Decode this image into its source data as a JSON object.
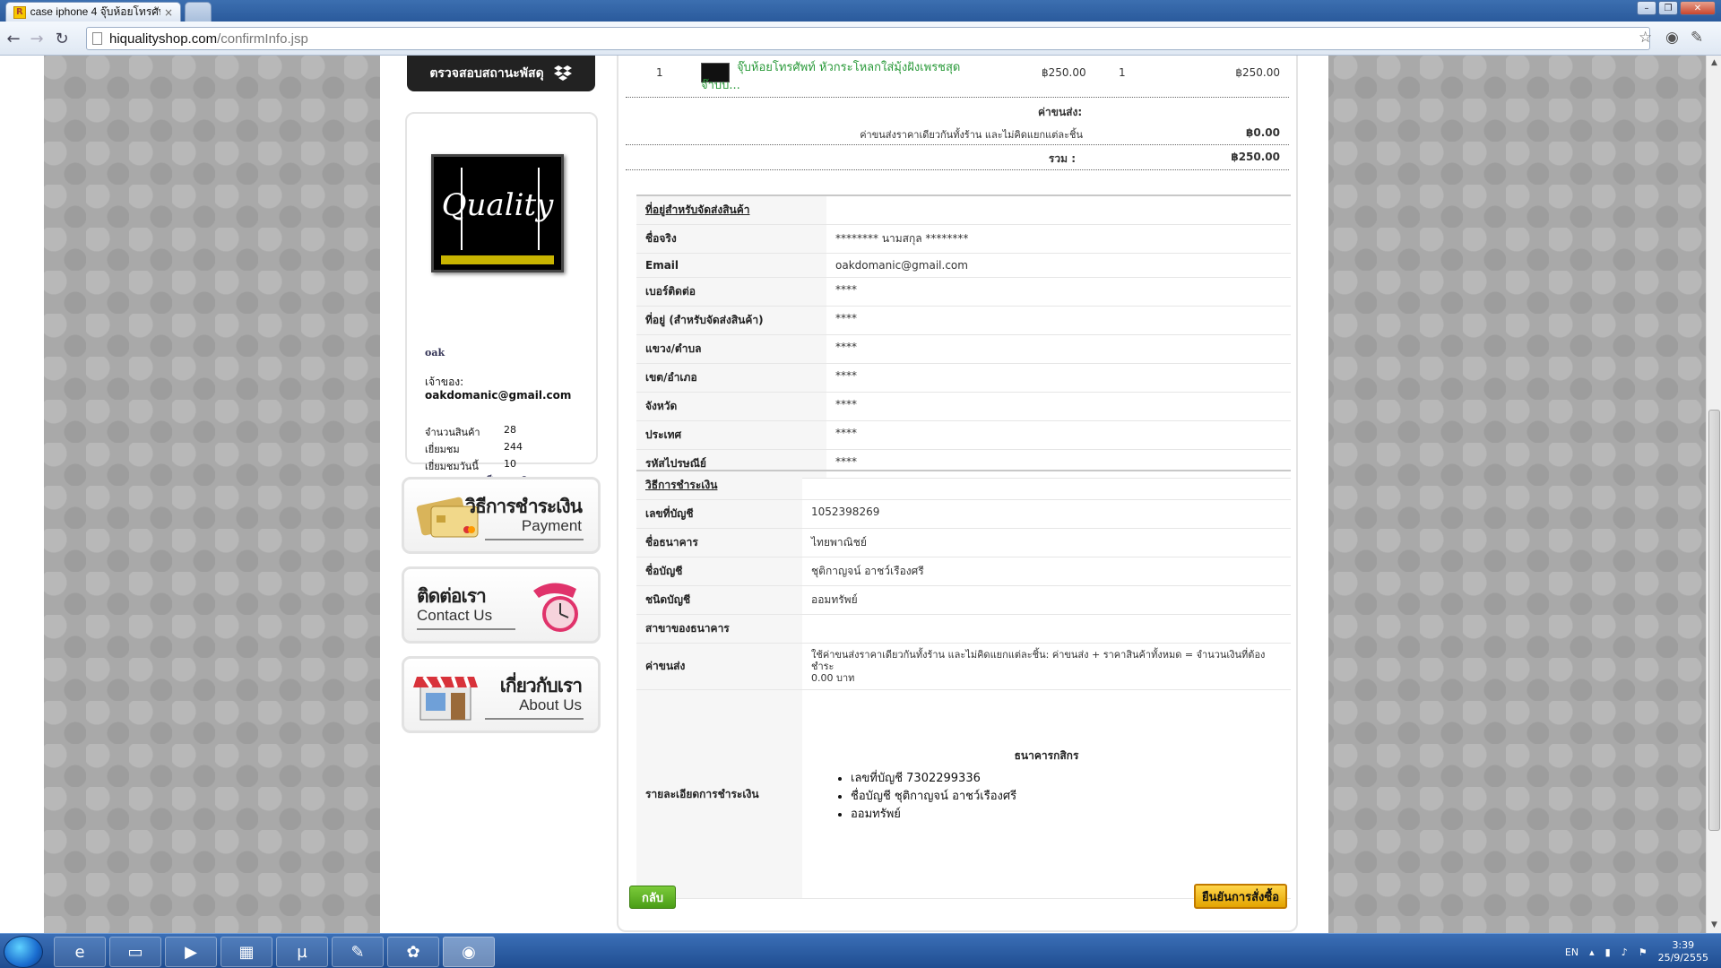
{
  "browser": {
    "tab_title": "case iphone 4 จุ๊บห้อยโทรศัพ",
    "tab_close": "×",
    "favicon_letter": "R",
    "url_host": "hiqualityshop.com",
    "url_path": "/confirmInfo.jsp",
    "win_min": "–",
    "win_max": "❐",
    "win_close": "✕"
  },
  "sidebar": {
    "track_label": "ตรวจสอบสถานะพัสดุ",
    "logo_text": "Quality",
    "shop_name": "oak",
    "owner_label": "เจ้าของ:",
    "owner_email": "oakdomanic@gmail.com",
    "stats": [
      {
        "label": "จำนวนสินค้า",
        "value": "28"
      },
      {
        "label": "เยี่ยมชม",
        "value": "244"
      },
      {
        "label": "เยี่ยมชมวันนี้",
        "value": "10"
      }
    ],
    "join_label": "ขอเป็นสมาชิก",
    "banners": {
      "payment": {
        "th": "วิธีการชำระเงิน",
        "en": "Payment"
      },
      "contact": {
        "th": "ติดต่อเรา",
        "en": "Contact Us"
      },
      "about": {
        "th": "เกี่ยวกับเรา",
        "en": "About Us"
      }
    }
  },
  "order": {
    "item": {
      "no": "1",
      "name": "จุ๊บห้อยโทรศัพท์ หัวกระโหลกใส่มุ้งฝังเพรชสุดจ๊าบบ...",
      "price": "฿250.00",
      "qty": "1",
      "total": "฿250.00"
    },
    "shipping_label": "ค่าขนส่ง:",
    "shipping_note": "ค่าขนส่งราคาเดียวกันทั้งร้าน และไม่คิดแยกแต่ละชิ้น",
    "shipping_value": "฿0.00",
    "sum_label": "รวม :",
    "sum_value": "฿250.00"
  },
  "address": {
    "heading": "ที่อยู่สำหรับจัดส่งสินค้า",
    "rows": [
      {
        "k": "ชื่อจริง",
        "v": "********     นามสกุล   ********"
      },
      {
        "k": "Email",
        "v": "oakdomanic@gmail.com"
      },
      {
        "k": "เบอร์ติดต่อ",
        "v": "****"
      },
      {
        "k": "ที่อยู่ (สำหรับจัดส่งสินค้า)",
        "v": "****"
      },
      {
        "k": "แขวง/ตำบล",
        "v": "****"
      },
      {
        "k": "เขต/อำเภอ",
        "v": "****"
      },
      {
        "k": "จังหวัด",
        "v": "****"
      },
      {
        "k": "ประเทศ",
        "v": "****"
      },
      {
        "k": "รหัสไปรษณีย์",
        "v": "****"
      }
    ]
  },
  "payment": {
    "heading": "วิธีการชำระเงิน",
    "rows": [
      {
        "k": "เลขที่บัญชี",
        "v": "1052398269"
      },
      {
        "k": "ชื่อธนาคาร",
        "v": "ไทยพาณิชย์"
      },
      {
        "k": "ชื่อบัญชี",
        "v": "ชุติกาญจน์ อาชว์เรืองศรี"
      },
      {
        "k": "ชนิดบัญชี",
        "v": "ออมทรัพย์"
      },
      {
        "k": "สาขาของธนาคาร",
        "v": ""
      }
    ],
    "shipping_k": "ค่าขนส่ง",
    "shipping_v1": "ใช้ค่าขนส่งราคาเดียวกันทั้งร้าน และไม่คิดแยกแต่ละชิ้น: ค่าขนส่ง + ราคาสินค้าทั้งหมด = จำนวนเงินที่ต้องชำระ",
    "shipping_v2": "0.00 บาท",
    "detail_k": "รายละเอียดการชำระเงิน",
    "detail_bank": "ธนาคารกสิกร",
    "detail_items": [
      "เลขที่บัญชี 7302299336",
      "ชื่อบัญชี ชุติกาญจน์   อาชว์เรืองศรี",
      "ออมทรัพย์"
    ]
  },
  "buttons": {
    "back": "กลับ",
    "confirm": "ยืนยันการสั่งซื้อ"
  },
  "taskbar": {
    "lang": "EN",
    "time": "3:39",
    "date": "25/9/2555"
  },
  "colors": {
    "product_link": "#2a9a3a",
    "back_button": "#5aae22",
    "confirm_button": "#f0b400"
  }
}
